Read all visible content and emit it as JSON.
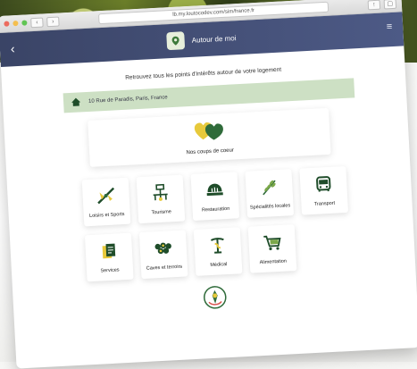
{
  "browser": {
    "url": "lb.my.loutocodev.com/sim/france.fr"
  },
  "header": {
    "back_label": "‹",
    "title": "Autour de moi",
    "menu_label": "≡"
  },
  "content": {
    "intro": "Retrouvez tous les points d'intérêts autour de votre logement",
    "address": "10 Rue de Paradis, Paris, France",
    "favorites_label": "Nos coups de coeur"
  },
  "categories_row1": [
    {
      "label": "Loisirs et Sports",
      "icon": "kayak-icon"
    },
    {
      "label": "Tourisme",
      "icon": "monument-icon"
    },
    {
      "label": "Restauration",
      "icon": "cloche-icon"
    },
    {
      "label": "Spécialités locales",
      "icon": "wheat-icon"
    },
    {
      "label": "Transport",
      "icon": "bus-icon"
    }
  ],
  "categories_row2": [
    {
      "label": "Services",
      "icon": "documents-icon"
    },
    {
      "label": "Caves et terroirs",
      "icon": "grapes-icon"
    },
    {
      "label": "Médical",
      "icon": "caduceus-icon"
    },
    {
      "label": "Alimentation",
      "icon": "cart-icon"
    }
  ],
  "colors": {
    "header": "#3a4466",
    "accent_yellow": "#e7c93b",
    "accent_green": "#2f6b3a",
    "address_bg": "#cde0c4"
  }
}
